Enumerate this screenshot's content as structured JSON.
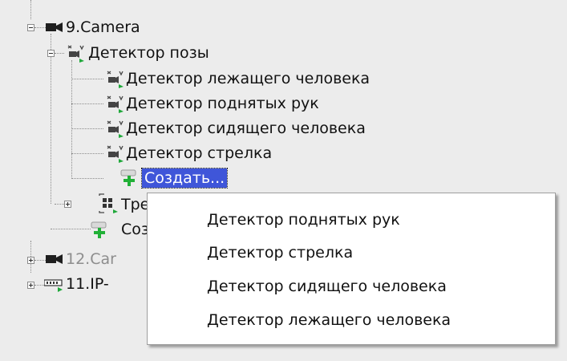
{
  "tree": {
    "nodes": [
      {
        "label": "9.Camera",
        "icon": "camera-icon"
      },
      {
        "label": "Детектор позы",
        "icon": "pose-detector-icon"
      },
      {
        "label": "Детектор лежащего человека",
        "icon": "pose-detector-icon"
      },
      {
        "label": "Детектор поднятых рук",
        "icon": "pose-detector-icon"
      },
      {
        "label": "Детектор сидящего человека",
        "icon": "pose-detector-icon"
      },
      {
        "label": "Детектор стрелка",
        "icon": "pose-detector-icon"
      },
      {
        "label": "Создать...",
        "icon": "create-add-icon"
      },
      {
        "label": "Тре",
        "icon": "tracker-icon"
      },
      {
        "label": "Соз",
        "icon": "create-add-icon"
      },
      {
        "label": "12.Car",
        "icon": "camera-icon"
      },
      {
        "label": "11.IP-",
        "icon": "ip-device-icon"
      }
    ]
  },
  "context_menu": {
    "items": [
      "Детектор поднятых рук",
      "Детектор стрелка",
      "Детектор сидящего человека",
      "Детектор лежащего человека"
    ]
  },
  "colors": {
    "selection": "#3f56d9",
    "panel_bg": "#ececec",
    "arrow_green": "#1fa83a",
    "dimmed_text": "#8d8d8d"
  }
}
